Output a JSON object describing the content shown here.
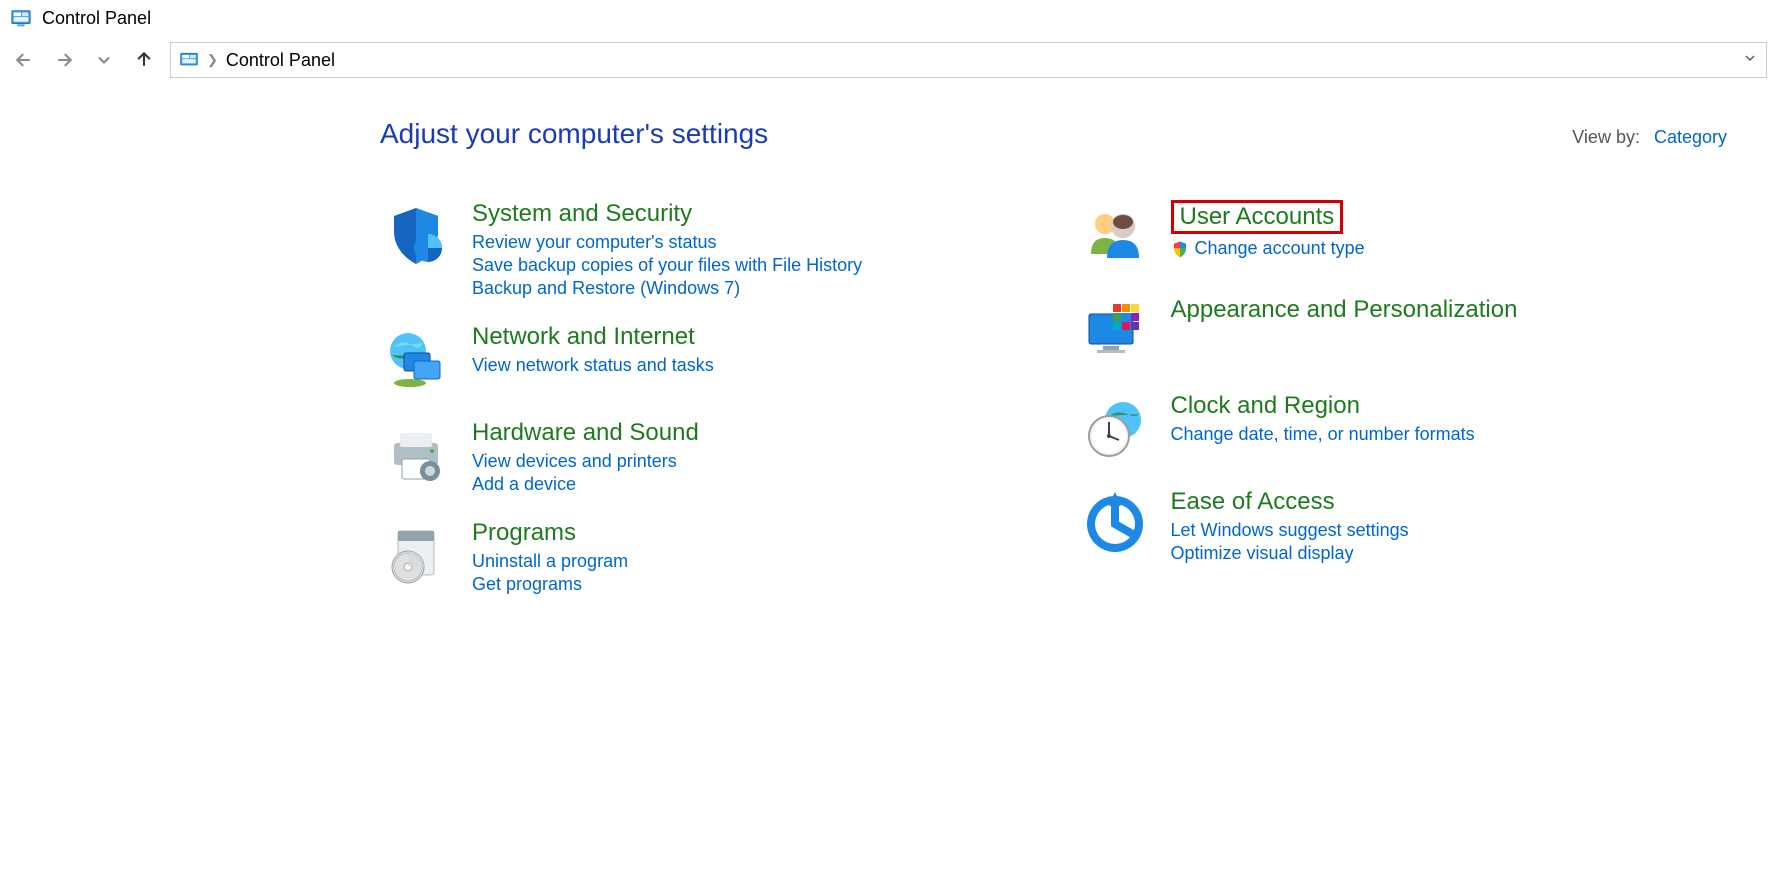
{
  "window": {
    "title": "Control Panel"
  },
  "address": {
    "location": "Control Panel"
  },
  "page": {
    "heading": "Adjust your computer's settings",
    "viewby_label": "View by:",
    "viewby_value": "Category"
  },
  "left_categories": [
    {
      "title": "System and Security",
      "icon": "shield-security-icon",
      "links": [
        {
          "text": "Review your computer's status",
          "shield": false
        },
        {
          "text": "Save backup copies of your files with File History",
          "shield": false
        },
        {
          "text": "Backup and Restore (Windows 7)",
          "shield": false
        }
      ]
    },
    {
      "title": "Network and Internet",
      "icon": "network-globe-icon",
      "links": [
        {
          "text": "View network status and tasks",
          "shield": false
        }
      ]
    },
    {
      "title": "Hardware and Sound",
      "icon": "printer-hardware-icon",
      "links": [
        {
          "text": "View devices and printers",
          "shield": false
        },
        {
          "text": "Add a device",
          "shield": false
        }
      ]
    },
    {
      "title": "Programs",
      "icon": "programs-disc-icon",
      "links": [
        {
          "text": "Uninstall a program",
          "shield": false
        },
        {
          "text": "Get programs",
          "shield": false
        }
      ]
    }
  ],
  "right_categories": [
    {
      "title": "User Accounts",
      "icon": "user-accounts-icon",
      "highlighted": true,
      "links": [
        {
          "text": "Change account type",
          "shield": true
        }
      ]
    },
    {
      "title": "Appearance and Personalization",
      "icon": "personalization-icon",
      "links": []
    },
    {
      "title": "Clock and Region",
      "icon": "clock-region-icon",
      "links": [
        {
          "text": "Change date, time, or number formats",
          "shield": false
        }
      ]
    },
    {
      "title": "Ease of Access",
      "icon": "ease-of-access-icon",
      "links": [
        {
          "text": "Let Windows suggest settings",
          "shield": false
        },
        {
          "text": "Optimize visual display",
          "shield": false
        }
      ]
    }
  ]
}
